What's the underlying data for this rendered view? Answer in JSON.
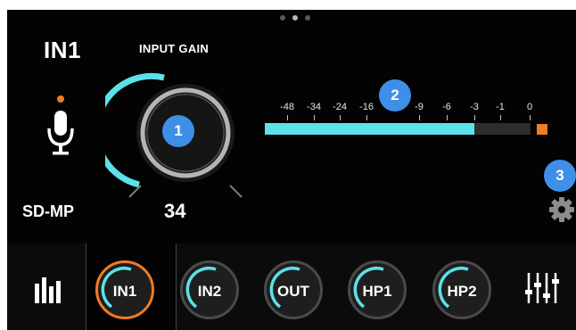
{
  "page_indicator": {
    "count": 3,
    "active": 1
  },
  "input": {
    "name": "IN1",
    "device": "SD-MP"
  },
  "gain": {
    "label": "INPUT GAIN",
    "value": "34"
  },
  "meter": {
    "ticks": [
      "-48",
      "-34",
      "-24",
      "-16",
      "-9",
      "-6",
      "-3",
      "-1",
      "0"
    ],
    "level_db": "-3",
    "peak": true
  },
  "badges": {
    "knob": "1",
    "meter": "2",
    "settings": "3"
  },
  "tabs": [
    {
      "label": "IN1",
      "selected": true
    },
    {
      "label": "IN2",
      "selected": false
    },
    {
      "label": "OUT",
      "selected": false
    },
    {
      "label": "HP1",
      "selected": false
    },
    {
      "label": "HP2",
      "selected": false
    }
  ],
  "icons": {
    "mic": "microphone-icon",
    "settings": "gear-icon",
    "meters": "level-bars-icon",
    "mixer": "mixer-sliders-icon"
  },
  "colors": {
    "accent": "#5ce1ea",
    "selected": "#f07b23",
    "badge": "#3f8fe8",
    "bg": "#030303"
  }
}
